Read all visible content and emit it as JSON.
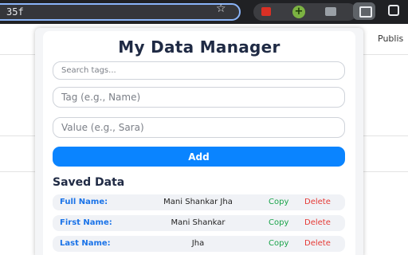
{
  "browser": {
    "address_fragment": "35f",
    "extension_icon_plus": "+"
  },
  "background_page": {
    "partial_text": "Publis"
  },
  "app": {
    "title": "My Data Manager",
    "search_placeholder": "Search tags...",
    "tag_placeholder": "Tag (e.g., Name)",
    "value_placeholder": "Value (e.g., Sara)",
    "add_label": "Add",
    "saved_title": "Saved Data",
    "copy_label": "Copy",
    "delete_label": "Delete",
    "entries": [
      {
        "label": "Full Name:",
        "value": "Mani Shankar Jha"
      },
      {
        "label": "First Name:",
        "value": "Mani Shankar"
      },
      {
        "label": "Last Name:",
        "value": "Jha"
      }
    ]
  },
  "colors": {
    "accent_blue": "#0a84ff",
    "label_blue": "#1a73e8",
    "copy_green": "#1aa34a",
    "delete_red": "#e53935",
    "title_navy": "#1f2a44"
  }
}
